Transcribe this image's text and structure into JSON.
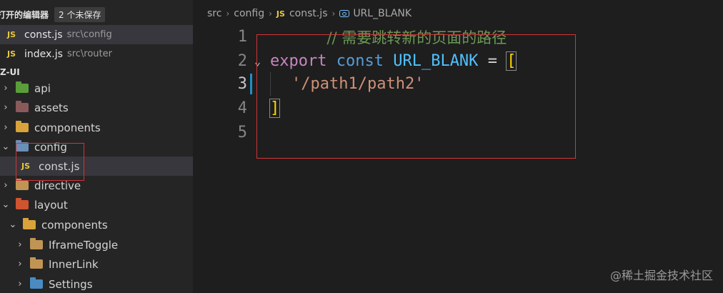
{
  "sidebar": {
    "open_editors": {
      "title": "打开的编辑器",
      "unsaved_badge": "2 个未保存",
      "files": [
        {
          "icon": "JS",
          "name": "const.js",
          "path": "src\\config"
        },
        {
          "icon": "JS",
          "name": "index.js",
          "path": "src\\router"
        }
      ]
    },
    "project_title": "Z-UI",
    "tree": [
      {
        "label": "api",
        "icon": "folder-api-icon"
      },
      {
        "label": "assets",
        "icon": "folder-assets-icon"
      },
      {
        "label": "components",
        "icon": "folder-components-icon"
      },
      {
        "label": "config",
        "icon": "folder-config-icon"
      },
      {
        "label": "const.js",
        "icon": "JS"
      },
      {
        "label": "directive",
        "icon": "folder-icon"
      },
      {
        "label": "layout",
        "icon": "folder-layout-icon"
      },
      {
        "label": "components",
        "icon": "folder-components-icon"
      },
      {
        "label": "IframeToggle",
        "icon": "folder-icon"
      },
      {
        "label": "InnerLink",
        "icon": "folder-icon"
      },
      {
        "label": "Settings",
        "icon": "folder-settings-icon"
      }
    ]
  },
  "editor": {
    "breadcrumb": [
      "src",
      "config",
      "const.js",
      "URL_BLANK"
    ],
    "file_icon": "JS",
    "line_numbers": [
      "1",
      "2",
      "3",
      "4",
      "5"
    ],
    "current_line": "3",
    "code": {
      "comment": "// 需要跳转新的页面的路径",
      "kw_export": "export",
      "kw_const": "const",
      "identifier": "URL_BLANK",
      "op_eq": "=",
      "bracket_open": "[",
      "string": "'/path1/path2'",
      "bracket_close": "]"
    }
  },
  "watermark": "@稀土掘金技术社区",
  "colors": {
    "highlight_border": "#d13438",
    "js_badge": "#e8c83a"
  }
}
